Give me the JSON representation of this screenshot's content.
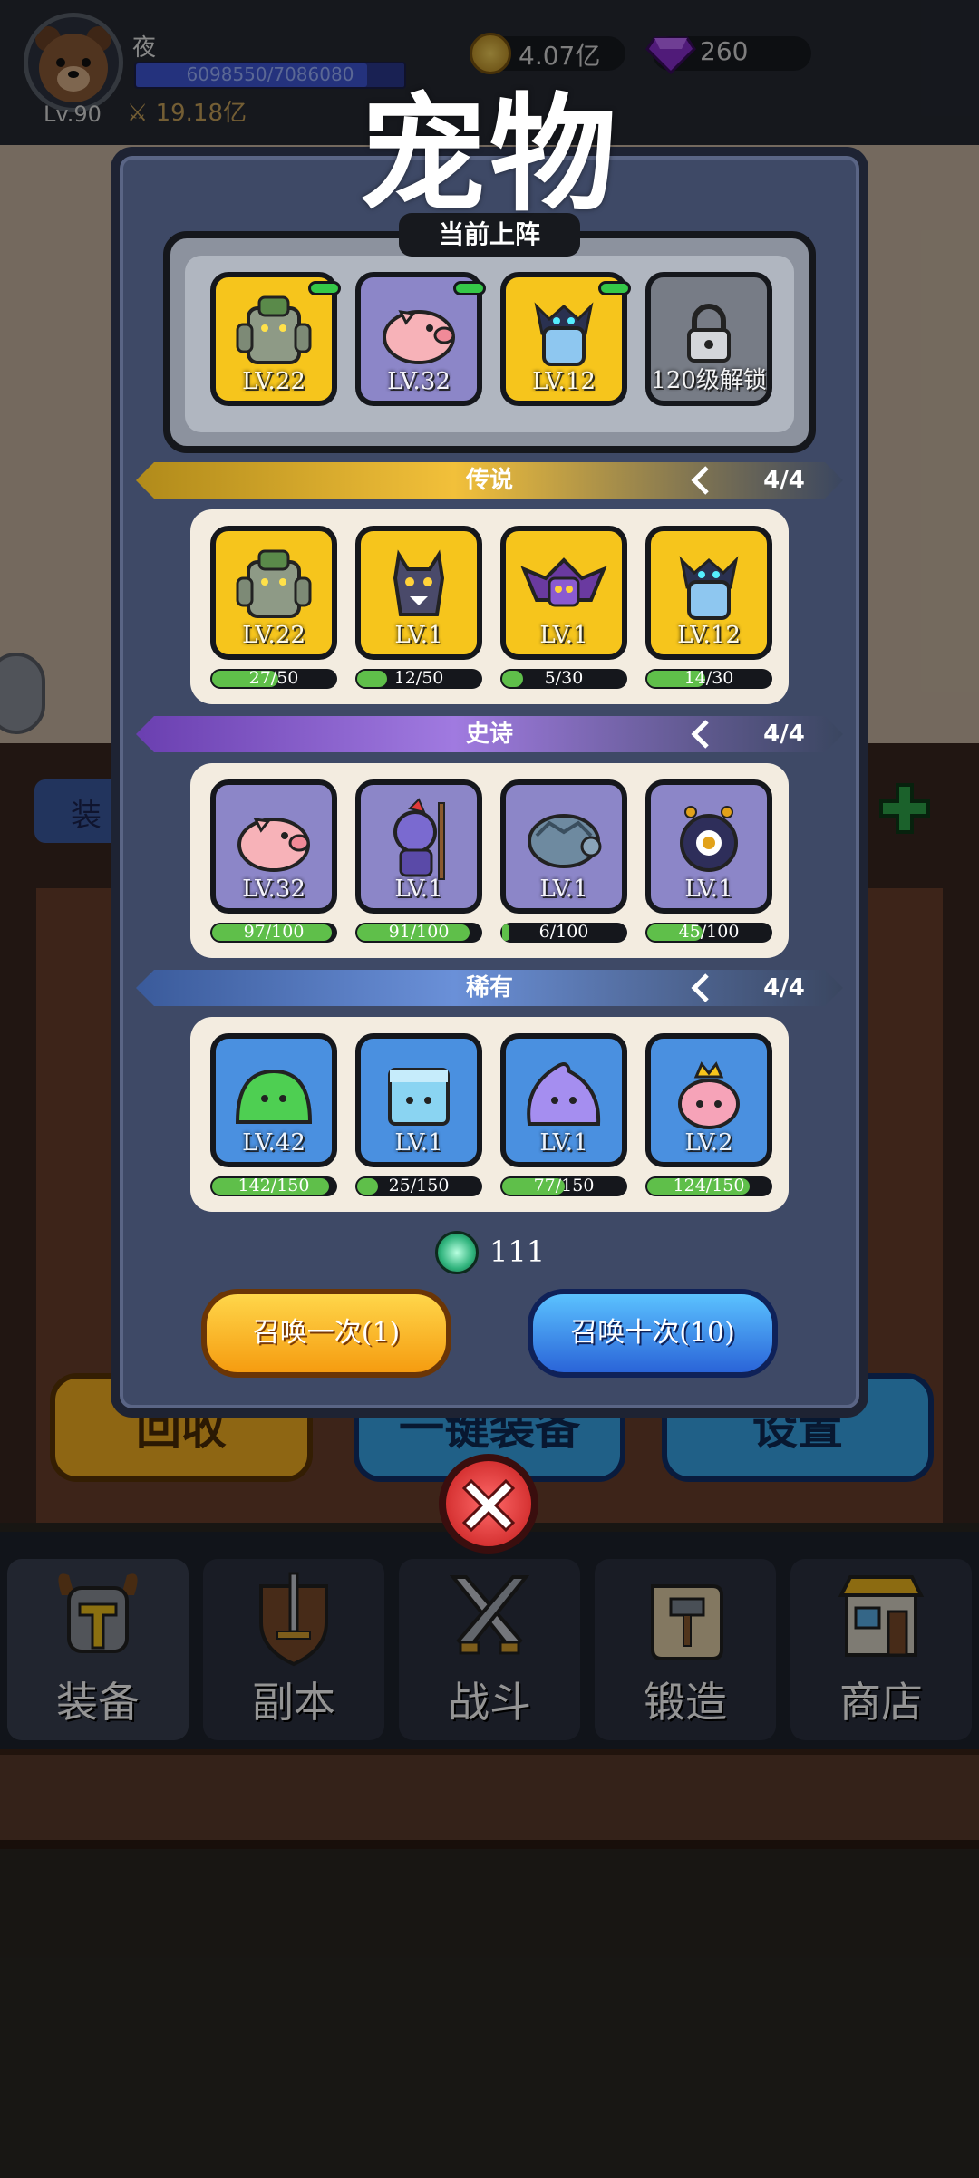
{
  "player": {
    "name": "夜",
    "level": "Lv.90",
    "xp": "6098550/7086080",
    "xp_fraction": 0.861,
    "power": "19.18亿"
  },
  "currency": {
    "coins": "4.07亿",
    "gems": "260"
  },
  "background": {
    "equip_tab": "装",
    "buttons": {
      "recycle": "回收",
      "one_click": "一键装备",
      "settings": "设置"
    }
  },
  "nav": [
    {
      "label": "装备",
      "icon": "helmet-icon"
    },
    {
      "label": "副本",
      "icon": "sword-shield-icon"
    },
    {
      "label": "战斗",
      "icon": "crossed-swords-icon"
    },
    {
      "label": "锻造",
      "icon": "scroll-hammer-icon"
    },
    {
      "label": "商店",
      "icon": "shop-icon"
    }
  ],
  "dialog": {
    "title": "宠物",
    "team_label": "当前上阵",
    "team": [
      {
        "lv": "LV.22",
        "color": "gold",
        "pet": "stone-golem"
      },
      {
        "lv": "LV.32",
        "color": "purple",
        "pet": "pig"
      },
      {
        "lv": "LV.12",
        "color": "gold",
        "pet": "ice-knight"
      },
      {
        "lv": "120级解锁",
        "color": "gray",
        "pet": "lock"
      }
    ],
    "groups": [
      {
        "name": "传说",
        "count": "4/4",
        "banner": [
          "#b08a1a",
          "#f2c03a",
          "#3a4660"
        ],
        "pets": [
          {
            "lv": "LV.22",
            "progress": "27/50",
            "fraction": 0.54,
            "color": "gold",
            "pet": "stone-golem"
          },
          {
            "lv": "LV.1",
            "progress": "12/50",
            "fraction": 0.24,
            "color": "gold",
            "pet": "werewolf"
          },
          {
            "lv": "LV.1",
            "progress": "5/30",
            "fraction": 0.17,
            "color": "gold",
            "pet": "bat-demon"
          },
          {
            "lv": "LV.12",
            "progress": "14/30",
            "fraction": 0.47,
            "color": "gold",
            "pet": "ice-knight"
          }
        ]
      },
      {
        "name": "史诗",
        "count": "4/4",
        "banner": [
          "#6a3fb0",
          "#a07ae0",
          "#3a4660"
        ],
        "pets": [
          {
            "lv": "LV.32",
            "progress": "97/100",
            "fraction": 0.97,
            "color": "purple",
            "pet": "pig"
          },
          {
            "lv": "LV.1",
            "progress": "91/100",
            "fraction": 0.91,
            "color": "purple",
            "pet": "goblin-spear"
          },
          {
            "lv": "LV.1",
            "progress": "6/100",
            "fraction": 0.06,
            "color": "purple",
            "pet": "rock-turtle"
          },
          {
            "lv": "LV.1",
            "progress": "45/100",
            "fraction": 0.45,
            "color": "purple",
            "pet": "eye-beholder"
          }
        ]
      },
      {
        "name": "稀有",
        "count": "4/4",
        "banner": [
          "#3a5a9a",
          "#6a90d8",
          "#3a4660"
        ],
        "pets": [
          {
            "lv": "LV.42",
            "progress": "142/150",
            "fraction": 0.95,
            "color": "blue",
            "pet": "green-slime"
          },
          {
            "lv": "LV.1",
            "progress": "25/150",
            "fraction": 0.17,
            "color": "blue",
            "pet": "ice-cube"
          },
          {
            "lv": "LV.1",
            "progress": "77/150",
            "fraction": 0.51,
            "color": "blue",
            "pet": "purple-slime"
          },
          {
            "lv": "LV.2",
            "progress": "124/150",
            "fraction": 0.83,
            "color": "blue",
            "pet": "pink-crown-slime"
          }
        ]
      }
    ],
    "crystal_count": "111",
    "summon_once": "召唤一次(1)",
    "summon_ten": "召唤十次(10)"
  }
}
